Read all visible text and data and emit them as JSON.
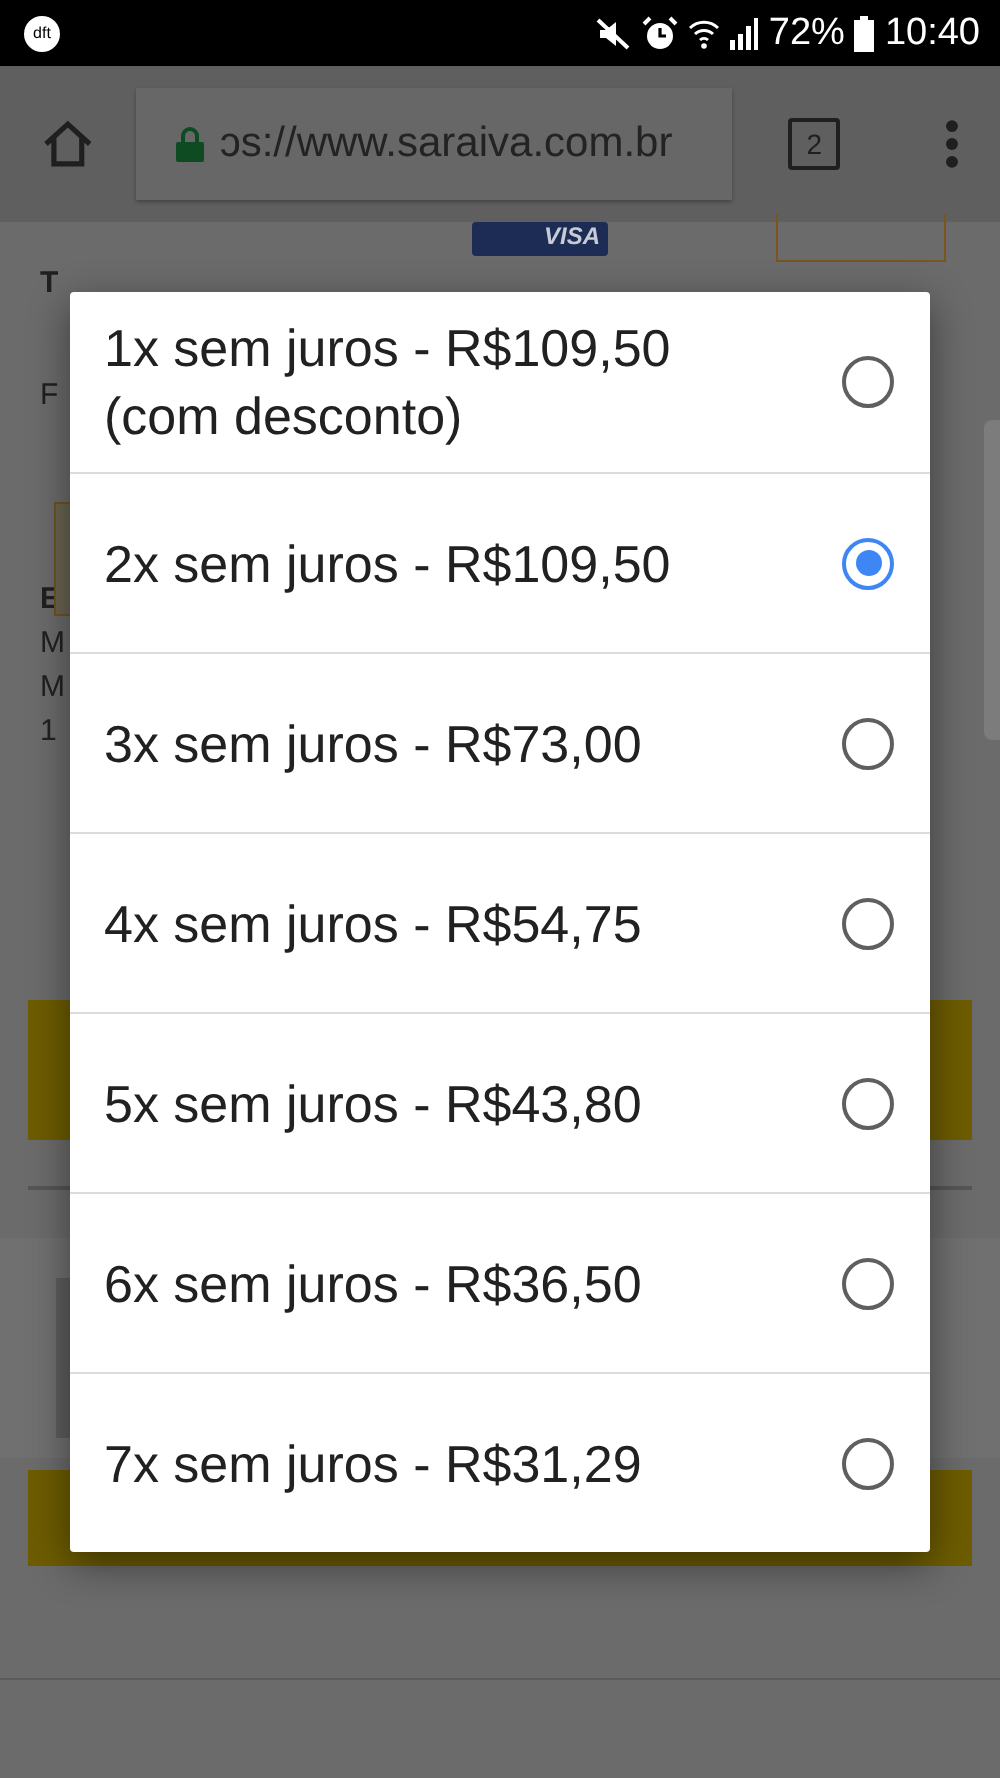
{
  "status_bar": {
    "app_badge": "dft",
    "battery": "72%",
    "time": "10:40"
  },
  "browser": {
    "url": "ɔs://www.saraiva.com.br",
    "tab_count": "2"
  },
  "page_behind": {
    "card_brand": "VISA",
    "fragments": [
      "T",
      "F",
      "E",
      "M",
      "M",
      "1"
    ]
  },
  "dialog": {
    "options": [
      {
        "label": "1x sem juros - R$109,50 (com desconto)",
        "selected": false
      },
      {
        "label": "2x sem juros - R$109,50",
        "selected": true
      },
      {
        "label": "3x sem juros - R$73,00",
        "selected": false
      },
      {
        "label": "4x sem juros - R$54,75",
        "selected": false
      },
      {
        "label": "5x sem juros - R$43,80",
        "selected": false
      },
      {
        "label": "6x sem juros - R$36,50",
        "selected": false
      },
      {
        "label": "7x sem juros - R$31,29",
        "selected": false
      }
    ]
  }
}
